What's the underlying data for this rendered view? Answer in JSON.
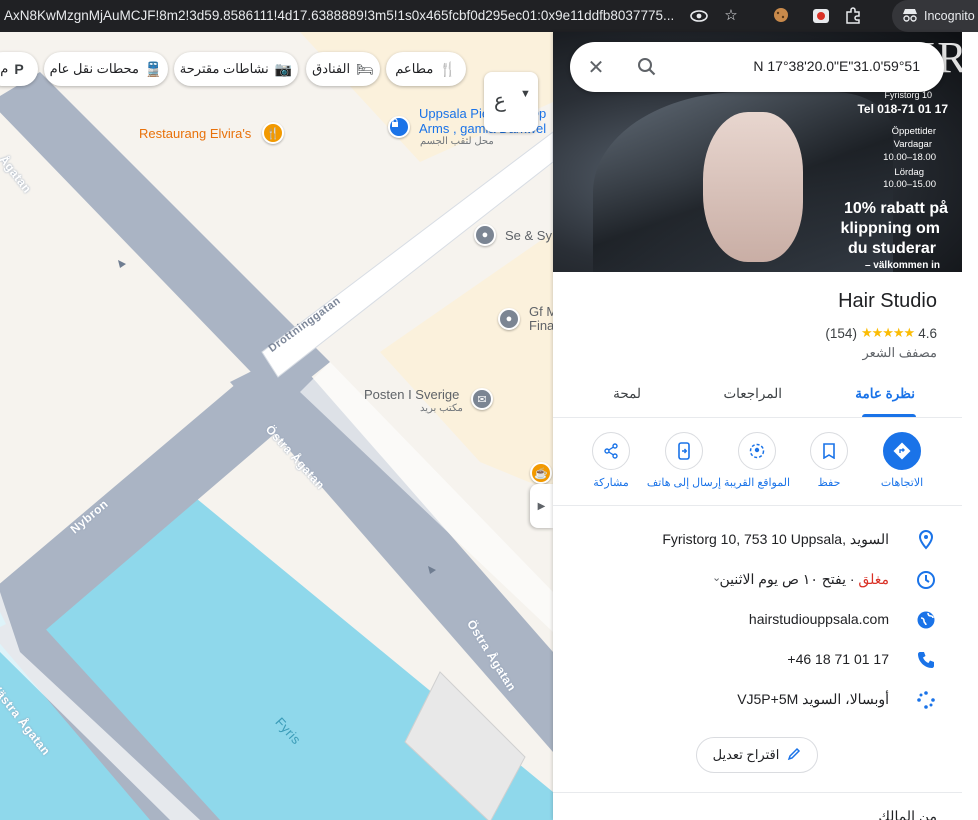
{
  "browser": {
    "url": "AxN8KwMzgnMjAuMCJF!8m2!3d59.8586111!4d17.6388889!3m5!1s0x465fcbf0d295ec01:0x9e11ddfb8037775...",
    "incognito_label": "Incognito"
  },
  "map": {
    "chips": [
      {
        "label": "مطاعم",
        "icon": "restaurant-icon"
      },
      {
        "label": "الفنادق",
        "icon": "hotel-icon"
      },
      {
        "label": "نشاطات مقترحة",
        "icon": "camera-icon"
      },
      {
        "label": "محطات نقل عام",
        "icon": "transit-icon"
      },
      {
        "label": "م",
        "icon": "parking-icon"
      }
    ],
    "side_toggle_label": "ع",
    "pois": {
      "elviras": "Restaurang Elvira's",
      "piercing_line1": "Uppsala Piercing - Op",
      "piercing_line2": "Arms , gamla Darkwel",
      "piercing_sub": "محل لثقب الجسم",
      "se_sy": "Se & Sy",
      "gf_line1": "Gf M",
      "gf_line2": "Fina",
      "posten": "Posten I Sverige",
      "posten_sub": "مكتب بريد"
    },
    "streets": {
      "agatan_top": "Ågatan",
      "drottninggatan": "Drottninggatan",
      "ostra1": "Östra Ågatan",
      "ostra2": "Östra Ågatan",
      "nybron": "Nybron",
      "vastra": "Västra Ågatan",
      "fyris": "Fyris"
    }
  },
  "search": {
    "query": "N 17°38'20.0\"E\"31.0'59°51"
  },
  "hero": {
    "brand": "HAIR",
    "address_line": "Fyristorg 10",
    "tel": "Tel 018-71 01 17",
    "hours_title": "Öppettider",
    "weekdays": "Vardagar",
    "weekday_hours": "10.00–18.00",
    "saturday": "Lördag",
    "saturday_hours": "10.00–15.00",
    "promo1": "10% rabatt på",
    "promo2": "klippning om",
    "promo3": "du studerar",
    "welcome": "– välkommen in"
  },
  "place": {
    "name": "Hair Studio",
    "rating": "4.6",
    "stars": "★★★★★",
    "reviews": "(154)",
    "category": "مصفف الشعر"
  },
  "tabs": [
    {
      "label": "نظرة عامة",
      "active": true
    },
    {
      "label": "المراجعات",
      "active": false
    },
    {
      "label": "لمحة",
      "active": false
    }
  ],
  "actions": {
    "directions": "الاتجاهات",
    "save": "حفظ",
    "nearby": "المواقع القريبة",
    "send_to_phone": "إرسال إلى هاتف",
    "share": "مشاركة"
  },
  "info": {
    "address": "Fyristorg 10, 753 10 Uppsala, السويد",
    "hours_status": "مغلق",
    "hours_detail": " · يفتح ١٠ ص يوم الاثنين",
    "website": "hairstudiouppsala.com",
    "phone": "+46 18 71 01 17",
    "plus_code": "VJ5P+5M أوبسالا، السويد"
  },
  "suggest_edit": "اقتراح تعديل",
  "next_section": "من المالك",
  "colors": {
    "accent": "#1a73e8",
    "closed": "#d93025",
    "water": "#8fd8eb",
    "road": "#aab4c4"
  }
}
